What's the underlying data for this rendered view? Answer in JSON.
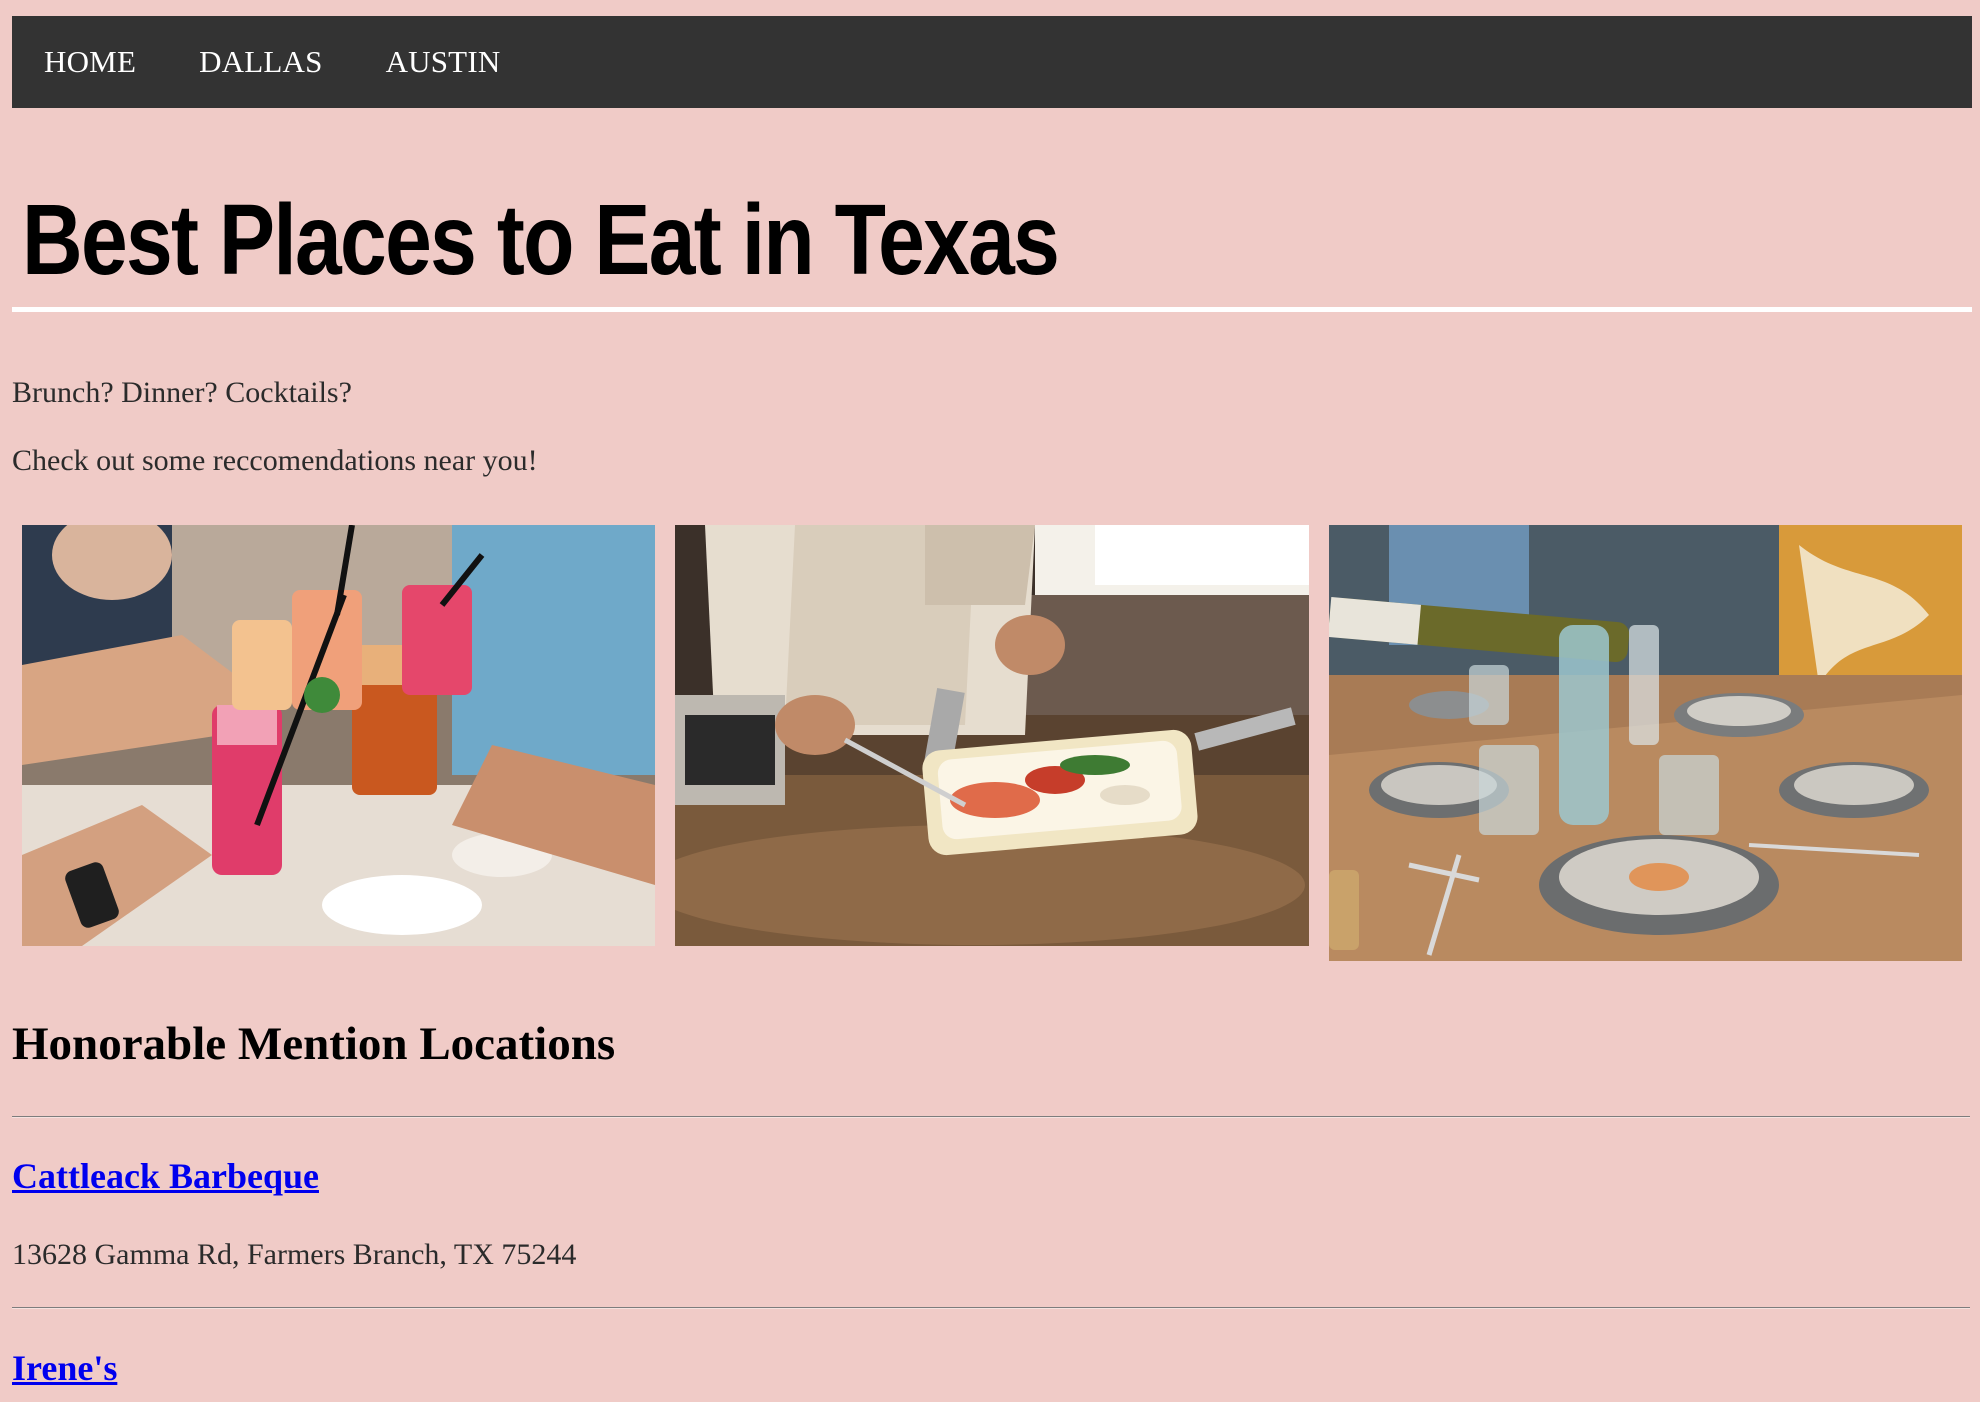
{
  "nav": {
    "items": [
      {
        "label": "HOME"
      },
      {
        "label": "DALLAS"
      },
      {
        "label": "AUSTIN"
      }
    ]
  },
  "header": {
    "title": "Best Places to Eat in Texas"
  },
  "intro": {
    "line1": "Brunch? Dinner? Cocktails?",
    "line2": "Check out some reccomendations near you!"
  },
  "gallery": {
    "images": [
      {
        "name": "cocktails-toast-photo"
      },
      {
        "name": "chef-plating-photo"
      },
      {
        "name": "wine-dinner-table-photo"
      }
    ]
  },
  "honorable": {
    "heading": "Honorable Mention Locations",
    "places": [
      {
        "name": "Cattleack Barbeque",
        "address": "13628 Gamma Rd, Farmers Branch, TX 75244"
      },
      {
        "name": "Irene's",
        "address": ""
      }
    ]
  },
  "colors": {
    "background": "#f0cbc7",
    "navbar": "#333333",
    "link": "#0000ee"
  }
}
